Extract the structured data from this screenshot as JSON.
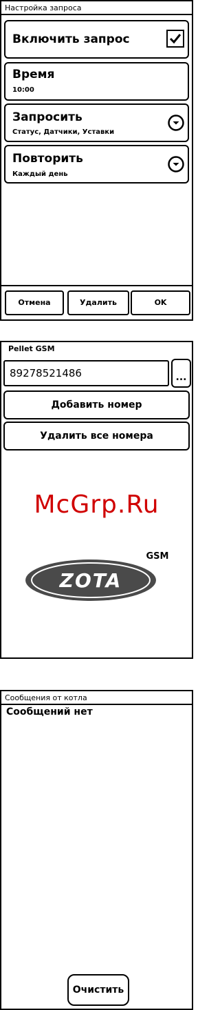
{
  "screen1": {
    "title": "Настройка запроса",
    "enable": {
      "label": "Включить запрос",
      "checked": true
    },
    "time": {
      "label": "Время",
      "value": "10:00"
    },
    "request": {
      "label": "Запросить",
      "value": "Статус, Датчики, Уставки"
    },
    "repeat": {
      "label": "Повторить",
      "value": "Каждый день"
    },
    "buttons": {
      "cancel": "Отмена",
      "delete": "Удалить",
      "ok": "OK"
    }
  },
  "screen2": {
    "title": "Pellet GSM",
    "phone": "89278521486",
    "more_label": "...",
    "add_label": "Добавить номер",
    "remove_all_label": "Удалить все номера",
    "watermark": "McGrp.Ru",
    "logo": {
      "brand": "ZOTA",
      "suffix": "GSM"
    }
  },
  "screen3": {
    "title": "Сообщения от котла",
    "empty_message": "Сообщений нет",
    "clear_label": "Очистить"
  },
  "icons": {
    "checkbox": "check-icon",
    "dropdown": "chevron-down-circle-icon"
  }
}
